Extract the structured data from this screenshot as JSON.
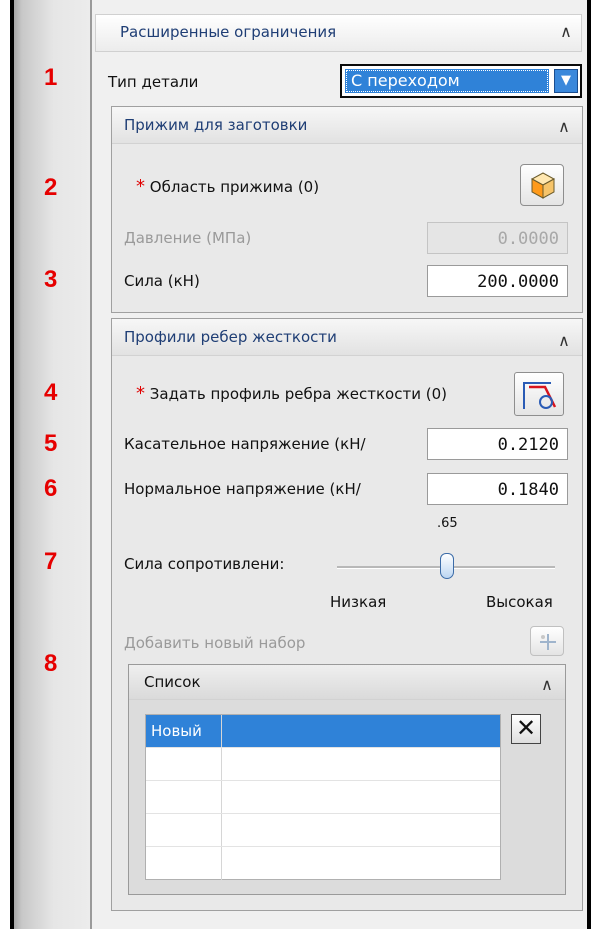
{
  "annotations": [
    "1",
    "2",
    "3",
    "4",
    "5",
    "6",
    "7",
    "8"
  ],
  "panel": {
    "title": "Расширенные ограничения",
    "part_type": {
      "label": "Тип детали",
      "value": "С переходом"
    },
    "blank_clamp": {
      "title": "Прижим для заготовки",
      "area_required": "*",
      "area_label": "Область прижима (0)",
      "pressure_label": "Давление (МПа)",
      "pressure_value": "0.0000",
      "force_label": "Сила (кН)",
      "force_value": "200.0000"
    },
    "ribs": {
      "title": "Профили ребер жесткости",
      "profile_required": "*",
      "profile_label": "Задать профиль ребра жесткости (0)",
      "tangential_label": "Касательное напряжение (кН/",
      "tangential_value": "0.2120",
      "normal_label": "Нормальное напряжение (кН/",
      "normal_value": "0.1840",
      "resistance_label": "Сила сопротивлени:",
      "resistance_value": ".65",
      "resistance_level": 0.5,
      "low_label": "Низкая",
      "high_label": "Высокая",
      "add_set_label": "Добавить новый набор"
    },
    "list": {
      "title": "Список",
      "rows": [
        "Новый",
        "",
        "",
        "",
        "",
        ""
      ]
    }
  },
  "colors": {
    "accent": "#2f82d8",
    "annotation": "#e60000",
    "required": "#e00000"
  }
}
